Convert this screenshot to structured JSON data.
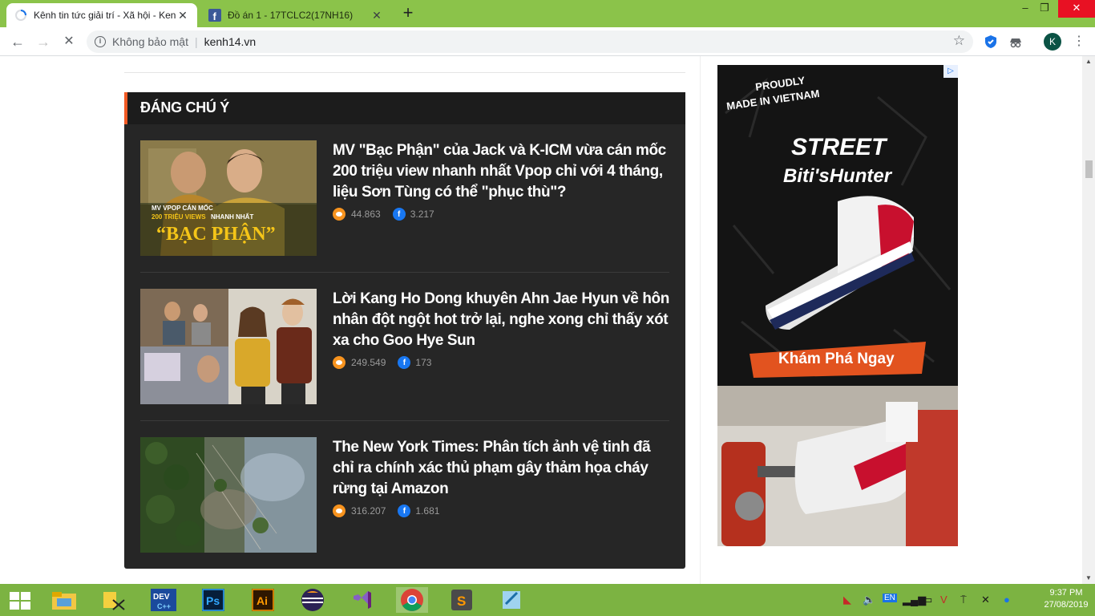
{
  "browser": {
    "tabs": [
      {
        "title": "Kênh tin tức giải trí - Xã hội - Ken",
        "close": "✕"
      },
      {
        "title": "Đồ án 1 - 17TCLC2(17NH16)",
        "close": "✕"
      }
    ],
    "new_tab": "+",
    "window_controls": {
      "minimize": "–",
      "maximize": "❐",
      "close": "✕"
    },
    "nav": {
      "back": "←",
      "forward": "→",
      "stop": "✕"
    },
    "address": {
      "security": "Không bảo mật",
      "separator": "|",
      "url": "kenh14.vn"
    },
    "profile_initial": "K"
  },
  "section": {
    "title": "ĐÁNG CHÚ Ý",
    "articles": [
      {
        "headline": "MV \"Bạc Phận\" của Jack và K-ICM vừa cán mốc 200 triệu view nhanh nhất Vpop chỉ với 4 tháng, liệu Sơn Tùng có thể \"phục thù\"?",
        "views": "44.863",
        "shares": "3.217",
        "thumb_caption_1": "MV VPOP CÁN MỐC",
        "thumb_caption_2": "200 TRIỆU VIEWS",
        "thumb_caption_3": "NHANH NHẤT",
        "thumb_caption_4": "“BẠC PHẬN”"
      },
      {
        "headline": "Lời Kang Ho Dong khuyên Ahn Jae Hyun về hôn nhân đột ngột hot trở lại, nghe xong chỉ thấy xót xa cho Goo Hye Sun",
        "views": "249.549",
        "shares": "173"
      },
      {
        "headline": "The New York Times: Phân tích ảnh vệ tinh đã chỉ ra chính xác thủ phạm gây thảm họa cháy rừng tại Amazon",
        "views": "316.207",
        "shares": "1.681"
      }
    ]
  },
  "ad": {
    "tagline_1": "PROUDLY",
    "tagline_2": "MADE IN VIETNAM",
    "product_line": "STREET",
    "brand": "Biti'sHunter",
    "cta": "Khám Phá Ngay",
    "badge": "▷"
  },
  "taskbar": {
    "apps": [
      "file-explorer",
      "network-tool",
      "dev-cpp",
      "photoshop",
      "illustrator",
      "eclipse",
      "visual-studio",
      "chrome",
      "sublime-text",
      "notepad"
    ],
    "dev_label": "DEV",
    "ps_label": "Ps",
    "ai_label": "Ai",
    "sublime_label": "S",
    "time": "9:37 PM",
    "date": "27/08/2019"
  }
}
